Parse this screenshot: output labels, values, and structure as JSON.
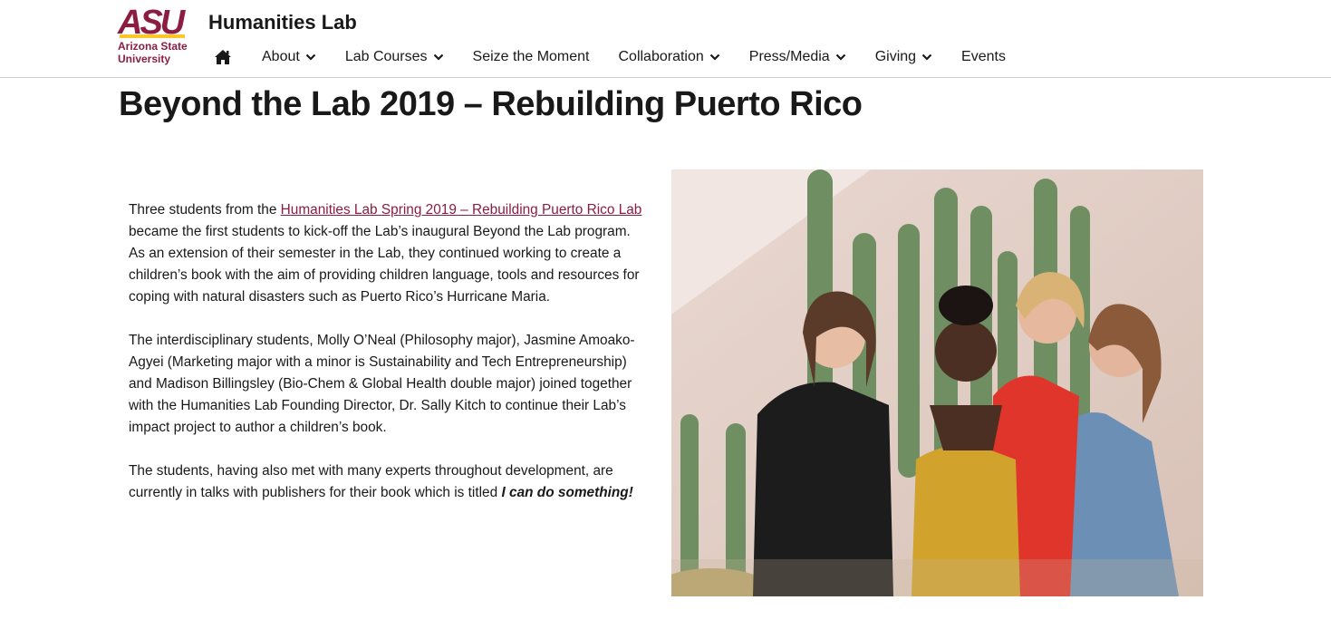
{
  "header": {
    "logo_mark": "ASU",
    "logo_line1": "Arizona State",
    "logo_line2": "University",
    "site_title": "Humanities Lab",
    "nav": [
      {
        "label": "About",
        "dropdown": true
      },
      {
        "label": "Lab Courses",
        "dropdown": true
      },
      {
        "label": "Seize the Moment",
        "dropdown": false
      },
      {
        "label": "Collaboration",
        "dropdown": true
      },
      {
        "label": "Press/Media",
        "dropdown": true
      },
      {
        "label": "Giving",
        "dropdown": true
      },
      {
        "label": "Events",
        "dropdown": false
      }
    ],
    "home_icon": "home-icon"
  },
  "page": {
    "title": "Beyond the Lab 2019 – Rebuilding Puerto Rico",
    "p1_before": "Three students from the ",
    "p1_link": "Humanities Lab Spring 2019 – Rebuilding Puerto Rico Lab",
    "p1_after": " became the first students to kick-off the Lab’s inaugural Beyond the Lab program. As an extension of their semester in the Lab, they continued working to create a children’s book with the aim of providing children language, tools and resources for coping with natural disasters such as Puerto Rico’s Hurricane Maria.",
    "p2": "The interdisciplinary students, Molly O’Neal (Philosophy major), Jasmine Amoako-Agyei (Marketing major with a minor is Sustainability and Tech Entrepreneurship) and Madison Billingsley (Bio-Chem & Global Health double major) joined together with the Humanities Lab Founding Director, Dr. Sally Kitch to continue their Lab’s impact project to author a children’s book.",
    "p3_before": "The students, having also met with many experts throughout development, are currently in talks with publishers for their book which is titled ",
    "p3_title": "I can do something!"
  },
  "colors": {
    "maroon": "#8c1d40",
    "gold": "#ffc627",
    "text": "#191919"
  }
}
